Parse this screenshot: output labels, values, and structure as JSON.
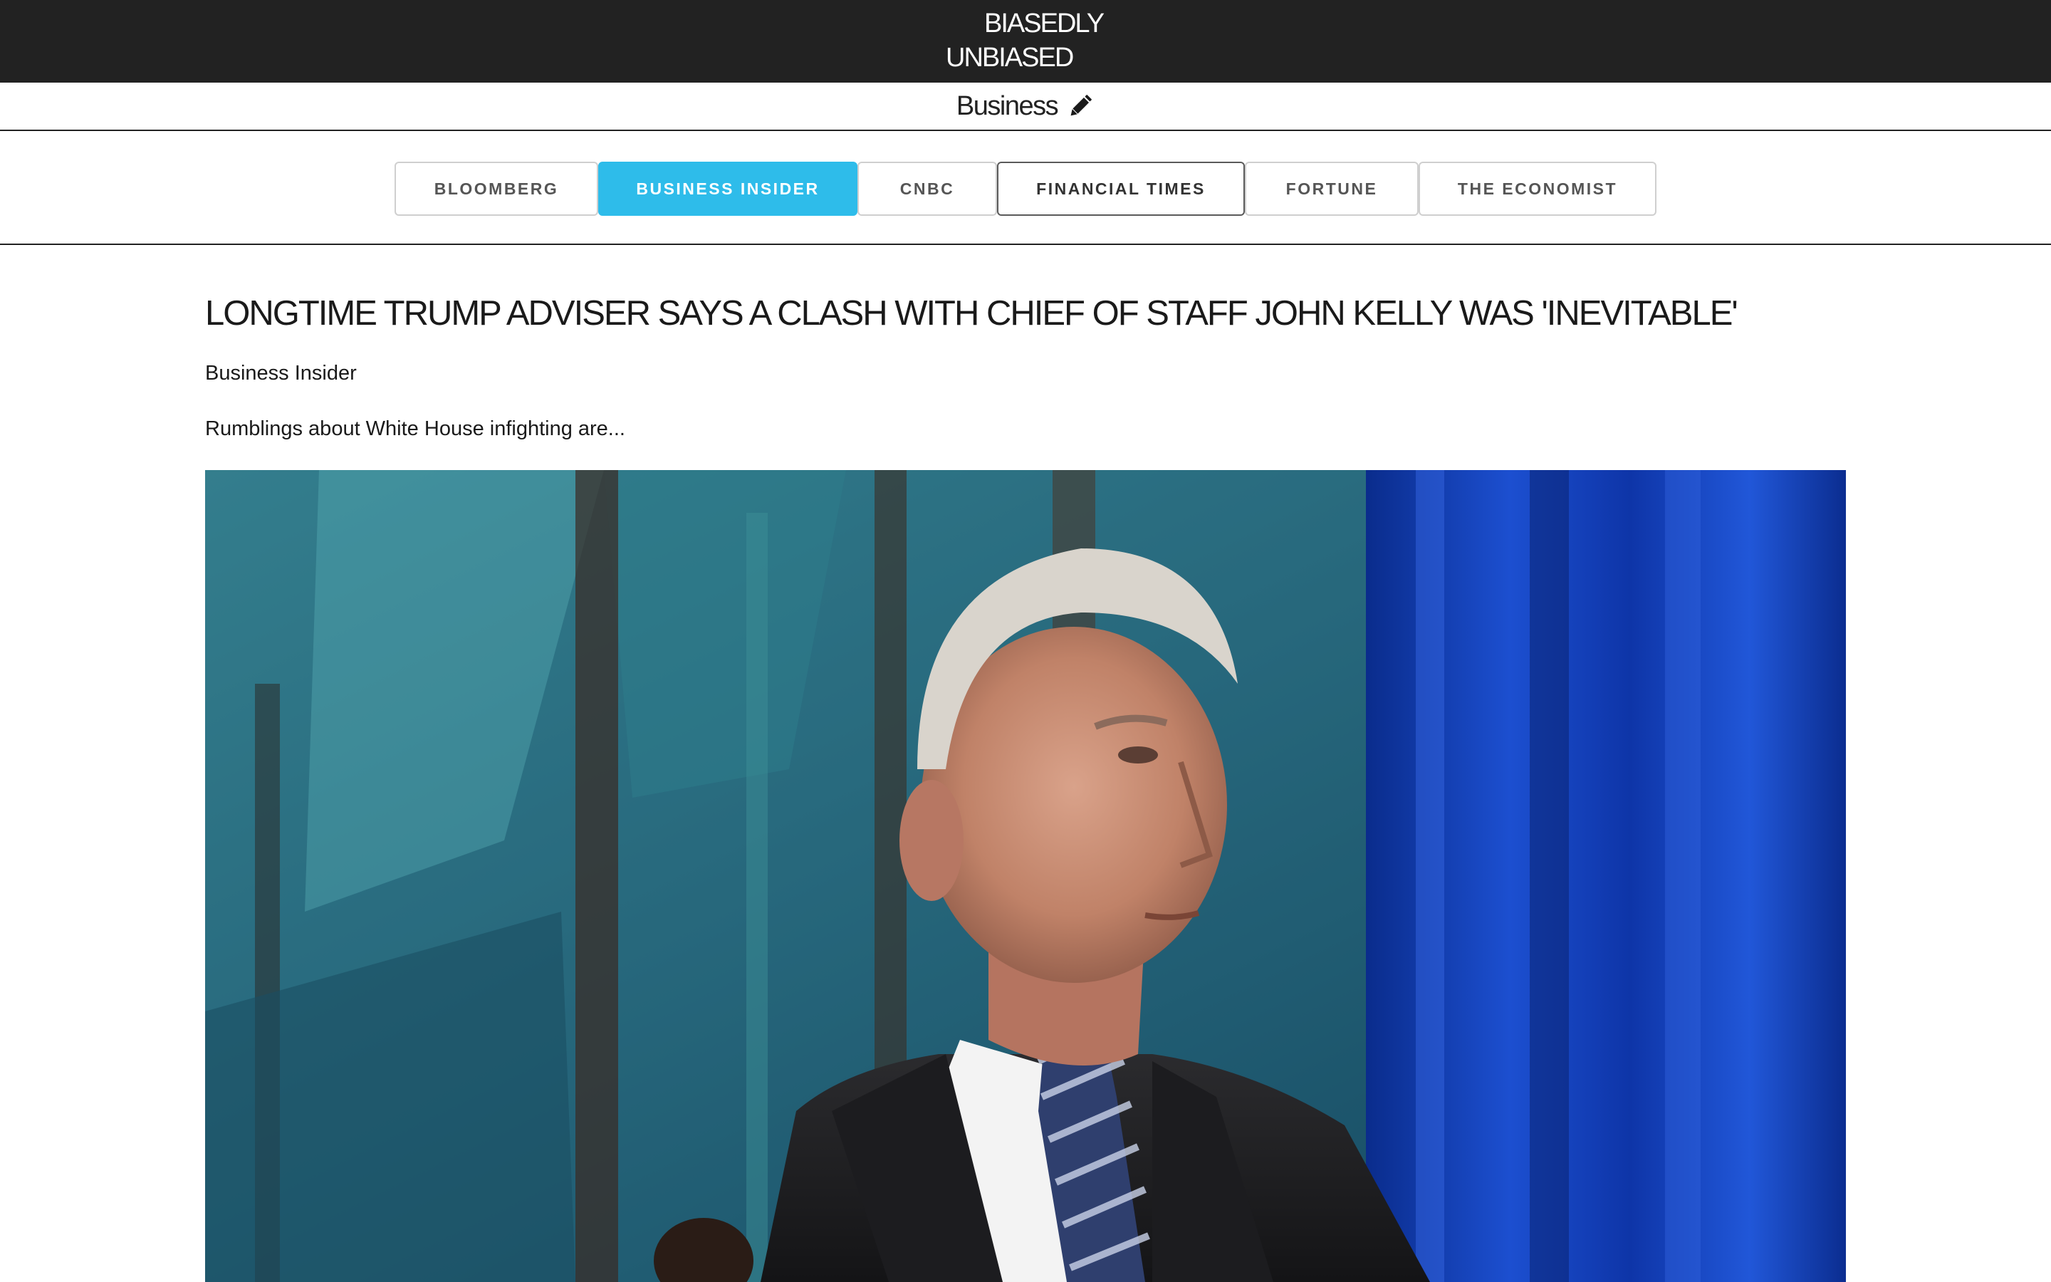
{
  "site": {
    "logo_line1": "BIASEDLY",
    "logo_line2": "UNBIASED"
  },
  "category": {
    "title": "Business",
    "edit_icon": "pencil-icon"
  },
  "sources": {
    "items": [
      {
        "label": "BLOOMBERG",
        "state": "default"
      },
      {
        "label": "BUSINESS INSIDER",
        "state": "active"
      },
      {
        "label": "CNBC",
        "state": "default"
      },
      {
        "label": "FINANCIAL TIMES",
        "state": "focused"
      },
      {
        "label": "FORTUNE",
        "state": "default"
      },
      {
        "label": "THE ECONOMIST",
        "state": "default"
      }
    ]
  },
  "article": {
    "headline": "LONGTIME TRUMP ADVISER SAYS A CLASH WITH CHIEF OF STAFF JOHN KELLY WAS 'INEVITABLE'",
    "source": "Business Insider",
    "summary": "Rumblings about White House infighting are..."
  },
  "colors": {
    "header_bg": "#222222",
    "accent": "#2ebcea",
    "border": "#cfcfcf"
  }
}
